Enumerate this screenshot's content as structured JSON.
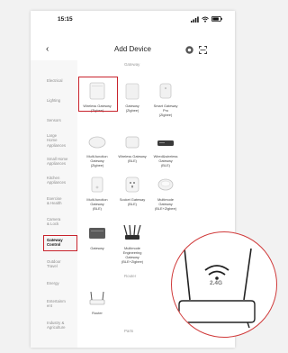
{
  "status": {
    "time": "15:15"
  },
  "header": {
    "title": "Add Device",
    "back_icon": "back-arrow-icon"
  },
  "sidebar": {
    "items": [
      {
        "label": "Electrical"
      },
      {
        "label": "Lighting"
      },
      {
        "label": "Sensors"
      },
      {
        "label": "Large\nHome\nAppliances"
      },
      {
        "label": "Small Home\nAppliances"
      },
      {
        "label": "Kitchen\nAppliances"
      },
      {
        "label": "Exercise\n& Health"
      },
      {
        "label": "Camera\n& Lock"
      },
      {
        "label": "Gateway\nControl"
      },
      {
        "label": "Outdoor\nTravel"
      },
      {
        "label": "Energy"
      },
      {
        "label": "Entertainm\nent"
      },
      {
        "label": "Industry &\nAgriculture"
      }
    ],
    "selected": "Gateway\nControl"
  },
  "sections": {
    "gateway": "Gateway",
    "router": "Router",
    "parts": "Parts"
  },
  "devices": {
    "d1": "Wireless Gateway\n(Zigbee)",
    "d2": "Gateway\n(Zigbee)",
    "d3": "Smart Gateway\nPro\n(Zigbee)",
    "d4": "Multi-function\nGateway\n(Zigbee)",
    "d5": "Wireless Gateway\n(BLE)",
    "d6": "Wired&wireless\nGateway\n(BLE)",
    "d7": "Multi-function\nGateway\n(BLE)",
    "d8": "Socket Gateway\n(BLE)",
    "d9": "Multimode\nGateway\n(BLE+Zigbee)",
    "d10": "Gateway",
    "d11": "Multimode\nEngineering\nGateway\n(BLE+Zigbee)",
    "d12": "Router"
  },
  "zoom": {
    "label": "2.4G"
  },
  "colors": {
    "highlight": "#c8232c"
  }
}
